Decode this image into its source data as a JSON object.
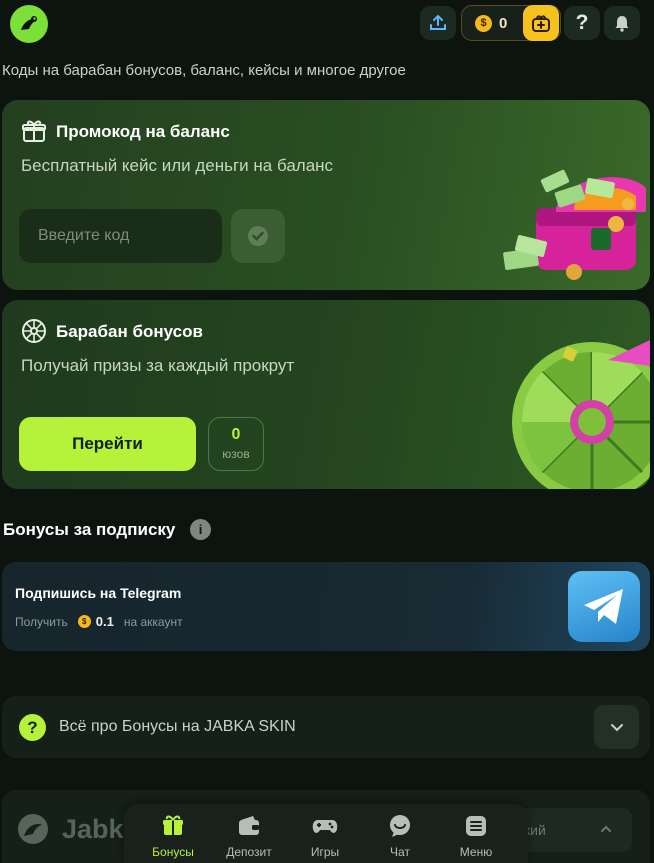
{
  "header": {
    "balance_value": "0",
    "icons": [
      "upload-icon",
      "coin-icon",
      "gift-icon",
      "question-icon",
      "bell-icon"
    ]
  },
  "page": {
    "subtitle": "Коды на барабан бонусов, баланс, кейсы и многое другое"
  },
  "promo": {
    "title": "Промокод на баланс",
    "description": "Бесплатный кейс или деньги на баланс",
    "input_placeholder": "Введите код"
  },
  "wheel": {
    "title": "Барабан бонусов",
    "description": "Получай призы за каждый прокрут",
    "go_label": "Перейти",
    "spins_count": "0",
    "spins_label": "юзов"
  },
  "subscription": {
    "section_title": "Бонусы за подписку",
    "telegram_title": "Подпишись на Telegram",
    "get_label": "Получить",
    "reward_amount": "0.1",
    "reward_suffix": "на аккаунт"
  },
  "faq": {
    "title": "Всё про Бонусы на JABKA SKIN"
  },
  "footer": {
    "brand_partial": "Jabk",
    "language_partial": "кий"
  },
  "nav": {
    "items": [
      {
        "label": "Бонусы",
        "active": true
      },
      {
        "label": "Депозит"
      },
      {
        "label": "Игры"
      },
      {
        "label": "Чат"
      },
      {
        "label": "Меню"
      }
    ]
  },
  "colors": {
    "accent": "#b6f23a",
    "background": "#0d1410",
    "card_green": "#24451f",
    "coin": "#f5b81f",
    "telegram": "#2a9ee0"
  }
}
